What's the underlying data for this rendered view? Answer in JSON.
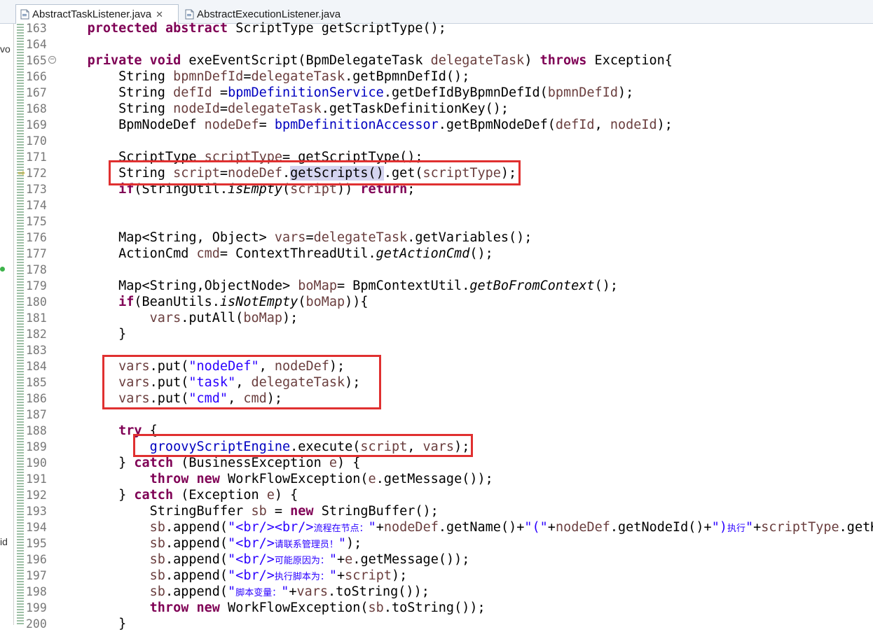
{
  "tabs": [
    {
      "label": "AbstractTaskListener.java",
      "active": true,
      "closable": true
    },
    {
      "label": "AbstractExecutionListener.java",
      "active": false,
      "closable": false
    }
  ],
  "left_panel": {
    "label_top": "vo",
    "label_bottom": "id"
  },
  "code_lines": [
    {
      "num": "163",
      "tokens": [
        [
          "    ",
          ""
        ],
        [
          "protected",
          "k"
        ],
        [
          " ",
          ""
        ],
        [
          "abstract",
          "k"
        ],
        [
          " ScriptType getScriptType();",
          ""
        ]
      ]
    },
    {
      "num": "164",
      "tokens": []
    },
    {
      "num": "165",
      "tokens": [
        [
          "    ",
          ""
        ],
        [
          "private",
          "k"
        ],
        [
          " ",
          ""
        ],
        [
          "void",
          "k"
        ],
        [
          " exeEventScript(BpmDelegateTask ",
          ""
        ],
        [
          "delegateTask",
          "v"
        ],
        [
          ") ",
          ""
        ],
        [
          "throws",
          "k"
        ],
        [
          " Exception{",
          ""
        ]
      ]
    },
    {
      "num": "166",
      "tokens": [
        [
          "        String ",
          ""
        ],
        [
          "bpmnDefId",
          "v"
        ],
        [
          "=",
          ""
        ],
        [
          "delegateTask",
          "v"
        ],
        [
          ".getBpmnDefId();",
          ""
        ]
      ]
    },
    {
      "num": "167",
      "tokens": [
        [
          "        String ",
          ""
        ],
        [
          "defId",
          "v"
        ],
        [
          " =",
          ""
        ],
        [
          "bpmDefinitionService",
          "f"
        ],
        [
          ".getDefIdByBpmnDefId(",
          ""
        ],
        [
          "bpmnDefId",
          "v"
        ],
        [
          ");",
          ""
        ]
      ]
    },
    {
      "num": "168",
      "tokens": [
        [
          "        String ",
          ""
        ],
        [
          "nodeId",
          "v"
        ],
        [
          "=",
          ""
        ],
        [
          "delegateTask",
          "v"
        ],
        [
          ".getTaskDefinitionKey();",
          ""
        ]
      ]
    },
    {
      "num": "169",
      "tokens": [
        [
          "        BpmNodeDef ",
          ""
        ],
        [
          "nodeDef",
          "v"
        ],
        [
          "= ",
          ""
        ],
        [
          "bpmDefinitionAccessor",
          "f"
        ],
        [
          ".getBpmNodeDef(",
          ""
        ],
        [
          "defId",
          "v"
        ],
        [
          ", ",
          ""
        ],
        [
          "nodeId",
          "v"
        ],
        [
          ");",
          ""
        ]
      ]
    },
    {
      "num": "170",
      "tokens": []
    },
    {
      "num": "171",
      "tokens": [
        [
          "        ScriptType ",
          ""
        ],
        [
          "scriptType",
          "v"
        ],
        [
          "= getScriptType();",
          ""
        ]
      ]
    },
    {
      "num": "172",
      "tokens": [
        [
          "        String ",
          ""
        ],
        [
          "script",
          "v"
        ],
        [
          "=",
          ""
        ],
        [
          "nodeDef",
          "v"
        ],
        [
          ".",
          ""
        ],
        [
          "getScripts()",
          "hl"
        ],
        [
          ".get(",
          ""
        ],
        [
          "scriptType",
          "v"
        ],
        [
          ");",
          ""
        ]
      ]
    },
    {
      "num": "173",
      "tokens": [
        [
          "        ",
          ""
        ],
        [
          "if",
          "k"
        ],
        [
          "(StringUtil.",
          ""
        ],
        [
          "isEmpty",
          "st"
        ],
        [
          "(",
          ""
        ],
        [
          "script",
          "v"
        ],
        [
          ")) ",
          ""
        ],
        [
          "return",
          "k"
        ],
        [
          ";",
          ""
        ]
      ]
    },
    {
      "num": "174",
      "tokens": []
    },
    {
      "num": "175",
      "tokens": []
    },
    {
      "num": "176",
      "tokens": [
        [
          "        Map<String, Object> ",
          ""
        ],
        [
          "vars",
          "v"
        ],
        [
          "=",
          ""
        ],
        [
          "delegateTask",
          "v"
        ],
        [
          ".getVariables();",
          ""
        ]
      ]
    },
    {
      "num": "177",
      "tokens": [
        [
          "        ActionCmd ",
          ""
        ],
        [
          "cmd",
          "v"
        ],
        [
          "= ContextThreadUtil.",
          ""
        ],
        [
          "getActionCmd",
          "st"
        ],
        [
          "();",
          ""
        ]
      ]
    },
    {
      "num": "178",
      "tokens": []
    },
    {
      "num": "179",
      "tokens": [
        [
          "        Map<String,ObjectNode> ",
          ""
        ],
        [
          "boMap",
          "v"
        ],
        [
          "= BpmContextUtil.",
          ""
        ],
        [
          "getBoFromContext",
          "st"
        ],
        [
          "();",
          ""
        ]
      ]
    },
    {
      "num": "180",
      "tokens": [
        [
          "        ",
          ""
        ],
        [
          "if",
          "k"
        ],
        [
          "(BeanUtils.",
          ""
        ],
        [
          "isNotEmpty",
          "st"
        ],
        [
          "(",
          ""
        ],
        [
          "boMap",
          "v"
        ],
        [
          ")){",
          ""
        ]
      ]
    },
    {
      "num": "181",
      "tokens": [
        [
          "            ",
          ""
        ],
        [
          "vars",
          "v"
        ],
        [
          ".putAll(",
          ""
        ],
        [
          "boMap",
          "v"
        ],
        [
          ");",
          ""
        ]
      ]
    },
    {
      "num": "182",
      "tokens": [
        [
          "        }",
          ""
        ]
      ]
    },
    {
      "num": "183",
      "tokens": []
    },
    {
      "num": "184",
      "tokens": [
        [
          "        ",
          ""
        ],
        [
          "vars",
          "v"
        ],
        [
          ".put(",
          ""
        ],
        [
          "\"nodeDef\"",
          "s"
        ],
        [
          ", ",
          ""
        ],
        [
          "nodeDef",
          "v"
        ],
        [
          ");",
          ""
        ]
      ]
    },
    {
      "num": "185",
      "tokens": [
        [
          "        ",
          ""
        ],
        [
          "vars",
          "v"
        ],
        [
          ".put(",
          ""
        ],
        [
          "\"task\"",
          "s"
        ],
        [
          ", ",
          ""
        ],
        [
          "delegateTask",
          "v"
        ],
        [
          ");",
          ""
        ]
      ]
    },
    {
      "num": "186",
      "tokens": [
        [
          "        ",
          ""
        ],
        [
          "vars",
          "v"
        ],
        [
          ".put(",
          ""
        ],
        [
          "\"cmd\"",
          "s"
        ],
        [
          ", ",
          ""
        ],
        [
          "cmd",
          "v"
        ],
        [
          ");",
          ""
        ]
      ]
    },
    {
      "num": "187",
      "tokens": []
    },
    {
      "num": "188",
      "tokens": [
        [
          "        ",
          ""
        ],
        [
          "try",
          "k"
        ],
        [
          " {",
          ""
        ]
      ]
    },
    {
      "num": "189",
      "tokens": [
        [
          "            ",
          ""
        ],
        [
          "groovyScriptEngine",
          "f"
        ],
        [
          ".execute(",
          ""
        ],
        [
          "script",
          "v"
        ],
        [
          ", ",
          ""
        ],
        [
          "vars",
          "v"
        ],
        [
          ");",
          ""
        ]
      ]
    },
    {
      "num": "190",
      "tokens": [
        [
          "        } ",
          ""
        ],
        [
          "catch",
          "k"
        ],
        [
          " (BusinessException ",
          ""
        ],
        [
          "e",
          "v"
        ],
        [
          ") {",
          ""
        ]
      ]
    },
    {
      "num": "191",
      "tokens": [
        [
          "            ",
          ""
        ],
        [
          "throw",
          "k"
        ],
        [
          " ",
          ""
        ],
        [
          "new",
          "k"
        ],
        [
          " WorkFlowException(",
          ""
        ],
        [
          "e",
          "v"
        ],
        [
          ".getMessage());",
          ""
        ]
      ]
    },
    {
      "num": "192",
      "tokens": [
        [
          "        } ",
          ""
        ],
        [
          "catch",
          "k"
        ],
        [
          " (Exception ",
          ""
        ],
        [
          "e",
          "v"
        ],
        [
          ") {",
          ""
        ]
      ]
    },
    {
      "num": "193",
      "tokens": [
        [
          "            StringBuffer ",
          ""
        ],
        [
          "sb",
          "v"
        ],
        [
          " = ",
          ""
        ],
        [
          "new",
          "k"
        ],
        [
          " StringBuffer();",
          ""
        ]
      ]
    },
    {
      "num": "194",
      "tokens": [
        [
          "            ",
          ""
        ],
        [
          "sb",
          "v"
        ],
        [
          ".append(",
          ""
        ],
        [
          "\"<br/><br/>",
          "s"
        ],
        [
          "流程在节点：",
          "s cjk"
        ],
        [
          "\"",
          "s"
        ],
        [
          "+",
          ""
        ],
        [
          "nodeDef",
          "v"
        ],
        [
          ".getName()+",
          ""
        ],
        [
          "\"(\"",
          "s"
        ],
        [
          "+",
          ""
        ],
        [
          "nodeDef",
          "v"
        ],
        [
          ".getNodeId()+",
          ""
        ],
        [
          "\")",
          "s"
        ],
        [
          "执行",
          "s cjk"
        ],
        [
          "\"",
          "s"
        ],
        [
          "+",
          ""
        ],
        [
          "scriptType",
          "v"
        ],
        [
          ".getKey()",
          ""
        ]
      ]
    },
    {
      "num": "195",
      "tokens": [
        [
          "            ",
          ""
        ],
        [
          "sb",
          "v"
        ],
        [
          ".append(",
          ""
        ],
        [
          "\"<br/>",
          "s"
        ],
        [
          "请联系管理员！",
          "s cjk"
        ],
        [
          "\"",
          "s"
        ],
        [
          ");",
          ""
        ]
      ]
    },
    {
      "num": "196",
      "tokens": [
        [
          "            ",
          ""
        ],
        [
          "sb",
          "v"
        ],
        [
          ".append(",
          ""
        ],
        [
          "\"<br/>",
          "s"
        ],
        [
          "可能原因为：",
          "s cjk"
        ],
        [
          "\"",
          "s"
        ],
        [
          "+",
          ""
        ],
        [
          "e",
          "v"
        ],
        [
          ".getMessage());",
          ""
        ]
      ]
    },
    {
      "num": "197",
      "tokens": [
        [
          "            ",
          ""
        ],
        [
          "sb",
          "v"
        ],
        [
          ".append(",
          ""
        ],
        [
          "\"<br/>",
          "s"
        ],
        [
          "执行脚本为：",
          "s cjk"
        ],
        [
          "\"",
          "s"
        ],
        [
          "+",
          ""
        ],
        [
          "script",
          "v"
        ],
        [
          ");",
          ""
        ]
      ]
    },
    {
      "num": "198",
      "tokens": [
        [
          "            ",
          ""
        ],
        [
          "sb",
          "v"
        ],
        [
          ".append(",
          ""
        ],
        [
          "\"",
          "s"
        ],
        [
          "脚本变量：",
          "s cjk"
        ],
        [
          "\"",
          "s"
        ],
        [
          "+",
          ""
        ],
        [
          "vars",
          "v"
        ],
        [
          ".toString());",
          ""
        ]
      ]
    },
    {
      "num": "199",
      "tokens": [
        [
          "            ",
          ""
        ],
        [
          "throw",
          "k"
        ],
        [
          " ",
          ""
        ],
        [
          "new",
          "k"
        ],
        [
          " WorkFlowException(",
          ""
        ],
        [
          "sb",
          "v"
        ],
        [
          ".toString());",
          ""
        ]
      ]
    },
    {
      "num": "200",
      "tokens": [
        [
          "        }",
          ""
        ]
      ]
    }
  ],
  "colors": {
    "keyword": "#7f0055",
    "field": "#0000c0",
    "local_variable": "#6a3e3e",
    "string": "#2a00ff",
    "annotation_box": "#e03030",
    "occurrence_highlight": "#d4d4f0"
  }
}
